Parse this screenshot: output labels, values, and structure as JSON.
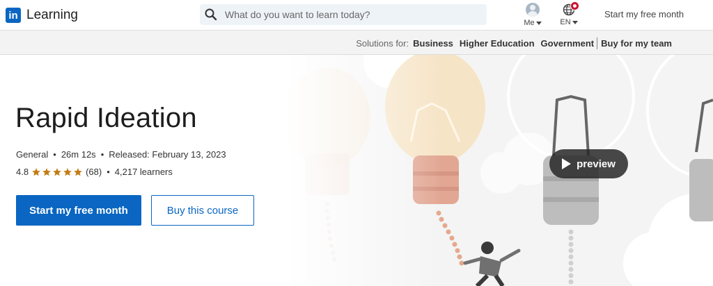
{
  "brand": {
    "logo_mark": "in",
    "name": "Learning",
    "color": "#0a66c2"
  },
  "search": {
    "placeholder": "What do you want to learn today?",
    "value": "",
    "icon": "search-icon"
  },
  "nav": {
    "me_label": "Me",
    "lang_label": "EN",
    "cta_label": "Start my free month"
  },
  "solutions": {
    "label": "Solutions for:",
    "links": [
      "Business",
      "Higher Education",
      "Government",
      "Buy for my team"
    ]
  },
  "course": {
    "title": "Rapid Ideation",
    "level": "General",
    "duration": "26m 12s",
    "released": "Released: February 13, 2023",
    "rating": "4.8",
    "rating_stars": 4.8,
    "rating_count": "(68)",
    "learners": "4,217 learners",
    "dot": "•",
    "primary_cta": "Start my free month",
    "secondary_cta": "Buy this course",
    "preview_label": "preview"
  },
  "colors": {
    "accent": "#0a66c2",
    "star": "#c37d16",
    "badge": "#cb112d"
  }
}
